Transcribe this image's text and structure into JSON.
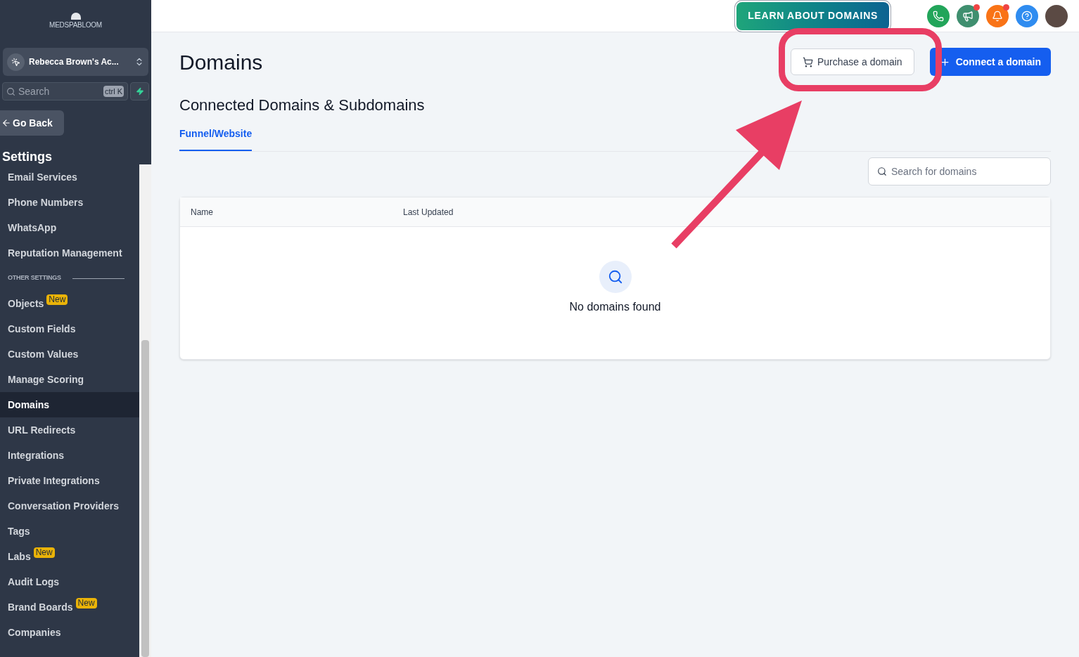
{
  "sidebar": {
    "logo": "MEDSPABLOOM",
    "account": "Rebecca Brown's Ac...",
    "search": {
      "placeholder": "Search",
      "shortcut": "ctrl K"
    },
    "back": "Go Back",
    "heading": "Settings",
    "items": [
      {
        "kind": "item",
        "label": "Email Services",
        "selected": false
      },
      {
        "kind": "item",
        "label": "Phone Numbers",
        "selected": false
      },
      {
        "kind": "item",
        "label": "WhatsApp",
        "selected": false
      },
      {
        "kind": "item",
        "label": "Reputation Management",
        "selected": false
      },
      {
        "kind": "section",
        "label": "OTHER SETTINGS"
      },
      {
        "kind": "item",
        "label": "Objects",
        "badge": "New",
        "selected": false
      },
      {
        "kind": "item",
        "label": "Custom Fields",
        "selected": false
      },
      {
        "kind": "item",
        "label": "Custom Values",
        "selected": false
      },
      {
        "kind": "item",
        "label": "Manage Scoring",
        "selected": false
      },
      {
        "kind": "item",
        "label": "Domains",
        "selected": true
      },
      {
        "kind": "item",
        "label": "URL Redirects",
        "selected": false
      },
      {
        "kind": "item",
        "label": "Integrations",
        "selected": false
      },
      {
        "kind": "item",
        "label": "Private Integrations",
        "selected": false
      },
      {
        "kind": "item",
        "label": "Conversation Providers",
        "selected": false
      },
      {
        "kind": "item",
        "label": "Tags",
        "selected": false
      },
      {
        "kind": "item",
        "label": "Labs",
        "badge": "New",
        "selected": false
      },
      {
        "kind": "item",
        "label": "Audit Logs",
        "selected": false
      },
      {
        "kind": "item",
        "label": "Brand Boards",
        "badge": "New",
        "selected": false
      },
      {
        "kind": "item",
        "label": "Companies",
        "selected": false
      }
    ]
  },
  "topbar": {
    "learn_button": "LEARN ABOUT DOMAINS",
    "icons": [
      {
        "kind": "phone",
        "color": "#22a55a",
        "dot": false
      },
      {
        "kind": "megaphone",
        "color": "#3f8f6f",
        "dot": true
      },
      {
        "kind": "bell",
        "color": "#f97316",
        "dot": true
      },
      {
        "kind": "help",
        "color": "#2f8cf0",
        "dot": false
      }
    ]
  },
  "page": {
    "title": "Domains",
    "purchase_button": "Purchase a domain",
    "connect_button": "Connect a domain",
    "subtitle": "Connected Domains & Subdomains",
    "tabs": [
      {
        "label": "Funnel/Website",
        "selected": true
      }
    ],
    "search": {
      "placeholder": "Search for domains"
    },
    "table": {
      "columns": [
        "Name",
        "Last Updated"
      ],
      "empty": "No domains found"
    }
  }
}
